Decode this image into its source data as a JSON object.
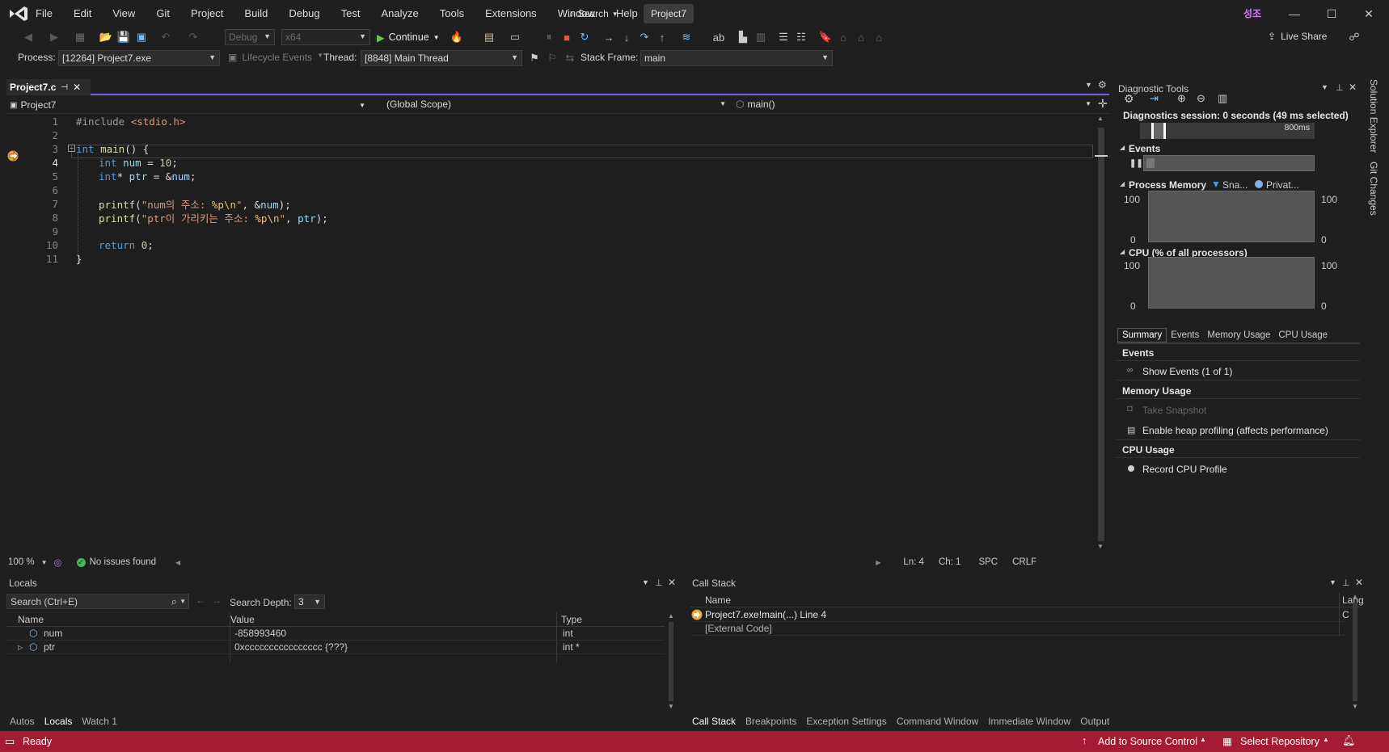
{
  "menu": [
    "File",
    "Edit",
    "View",
    "Git",
    "Project",
    "Build",
    "Debug",
    "Test",
    "Analyze",
    "Tools",
    "Extensions",
    "Window",
    "Help"
  ],
  "search_label": "Search",
  "project_badge": "Project7",
  "account_initials": "성조",
  "toolbar": {
    "config": "Debug",
    "platform": "x64",
    "continue_label": "Continue",
    "live_share": "Live Share"
  },
  "debug_location": {
    "process_label": "Process:",
    "process_value": "[12264] Project7.exe",
    "lifecycle_label": "Lifecycle Events",
    "thread_label": "Thread:",
    "thread_value": "[8848] Main Thread",
    "stack_frame_label": "Stack Frame:",
    "stack_frame_value": "main"
  },
  "editor": {
    "tab_title": "Project7.c",
    "nav_project": "Project7",
    "nav_scope": "(Global Scope)",
    "nav_function": "main()",
    "current_line": 4,
    "lines": [
      "1",
      "2",
      "3",
      "4",
      "5",
      "6",
      "7",
      "8",
      "9",
      "10",
      "11"
    ],
    "zoom": "100 %",
    "issues": "No issues found",
    "pos_ln": "Ln: 4",
    "pos_ch": "Ch: 1",
    "whitespace": "SPC",
    "line_ending": "CRLF"
  },
  "diagnostics": {
    "title": "Diagnostic Tools",
    "session": "Diagnostics session: 0 seconds (49 ms selected)",
    "timeline_label": "800ms",
    "events_title": "Events",
    "memory_title": "Process Memory",
    "memory_legend_1": "Sna...",
    "memory_legend_2": "Privat...",
    "memory_max_left": "100",
    "memory_min_left": "0",
    "memory_max_right": "100",
    "memory_min_right": "0",
    "cpu_title": "CPU (% of all processors)",
    "cpu_max_left": "100",
    "cpu_min_left": "0",
    "cpu_max_right": "100",
    "cpu_min_right": "0",
    "tabs": [
      "Summary",
      "Events",
      "Memory Usage",
      "CPU Usage"
    ],
    "summary_events_header": "Events",
    "show_events": "Show Events (1 of 1)",
    "summary_memory_header": "Memory Usage",
    "take_snapshot": "Take Snapshot",
    "heap_profiling": "Enable heap profiling (affects performance)",
    "summary_cpu_header": "CPU Usage",
    "record_cpu": "Record CPU Profile"
  },
  "side_tabs": [
    "Solution Explorer",
    "Git Changes"
  ],
  "locals": {
    "title": "Locals",
    "search_placeholder": "Search (Ctrl+E)",
    "search_depth_label": "Search Depth:",
    "search_depth_value": "3",
    "columns": [
      "Name",
      "Value",
      "Type"
    ],
    "rows": [
      {
        "name": "num",
        "value": "-858993460",
        "type": "int"
      },
      {
        "name": "ptr",
        "value": "0xcccccccccccccccc {???}",
        "type": "int *"
      }
    ],
    "tabs": [
      "Autos",
      "Locals",
      "Watch 1"
    ]
  },
  "callstack": {
    "title": "Call Stack",
    "columns": [
      "Name",
      "Lang"
    ],
    "rows": [
      {
        "name": "Project7.exe!main(...) Line 4",
        "lang": "C"
      },
      {
        "name": "[External Code]",
        "lang": ""
      }
    ],
    "tabs": [
      "Call Stack",
      "Breakpoints",
      "Exception Settings",
      "Command Window",
      "Immediate Window",
      "Output"
    ]
  },
  "status": {
    "ready": "Ready",
    "source_control": "Add to Source Control",
    "select_repo": "Select Repository"
  },
  "colors": {
    "status_bar": "#a31c33",
    "accent": "#7160e8",
    "breakpoint_arrow": "#e8a33d"
  }
}
